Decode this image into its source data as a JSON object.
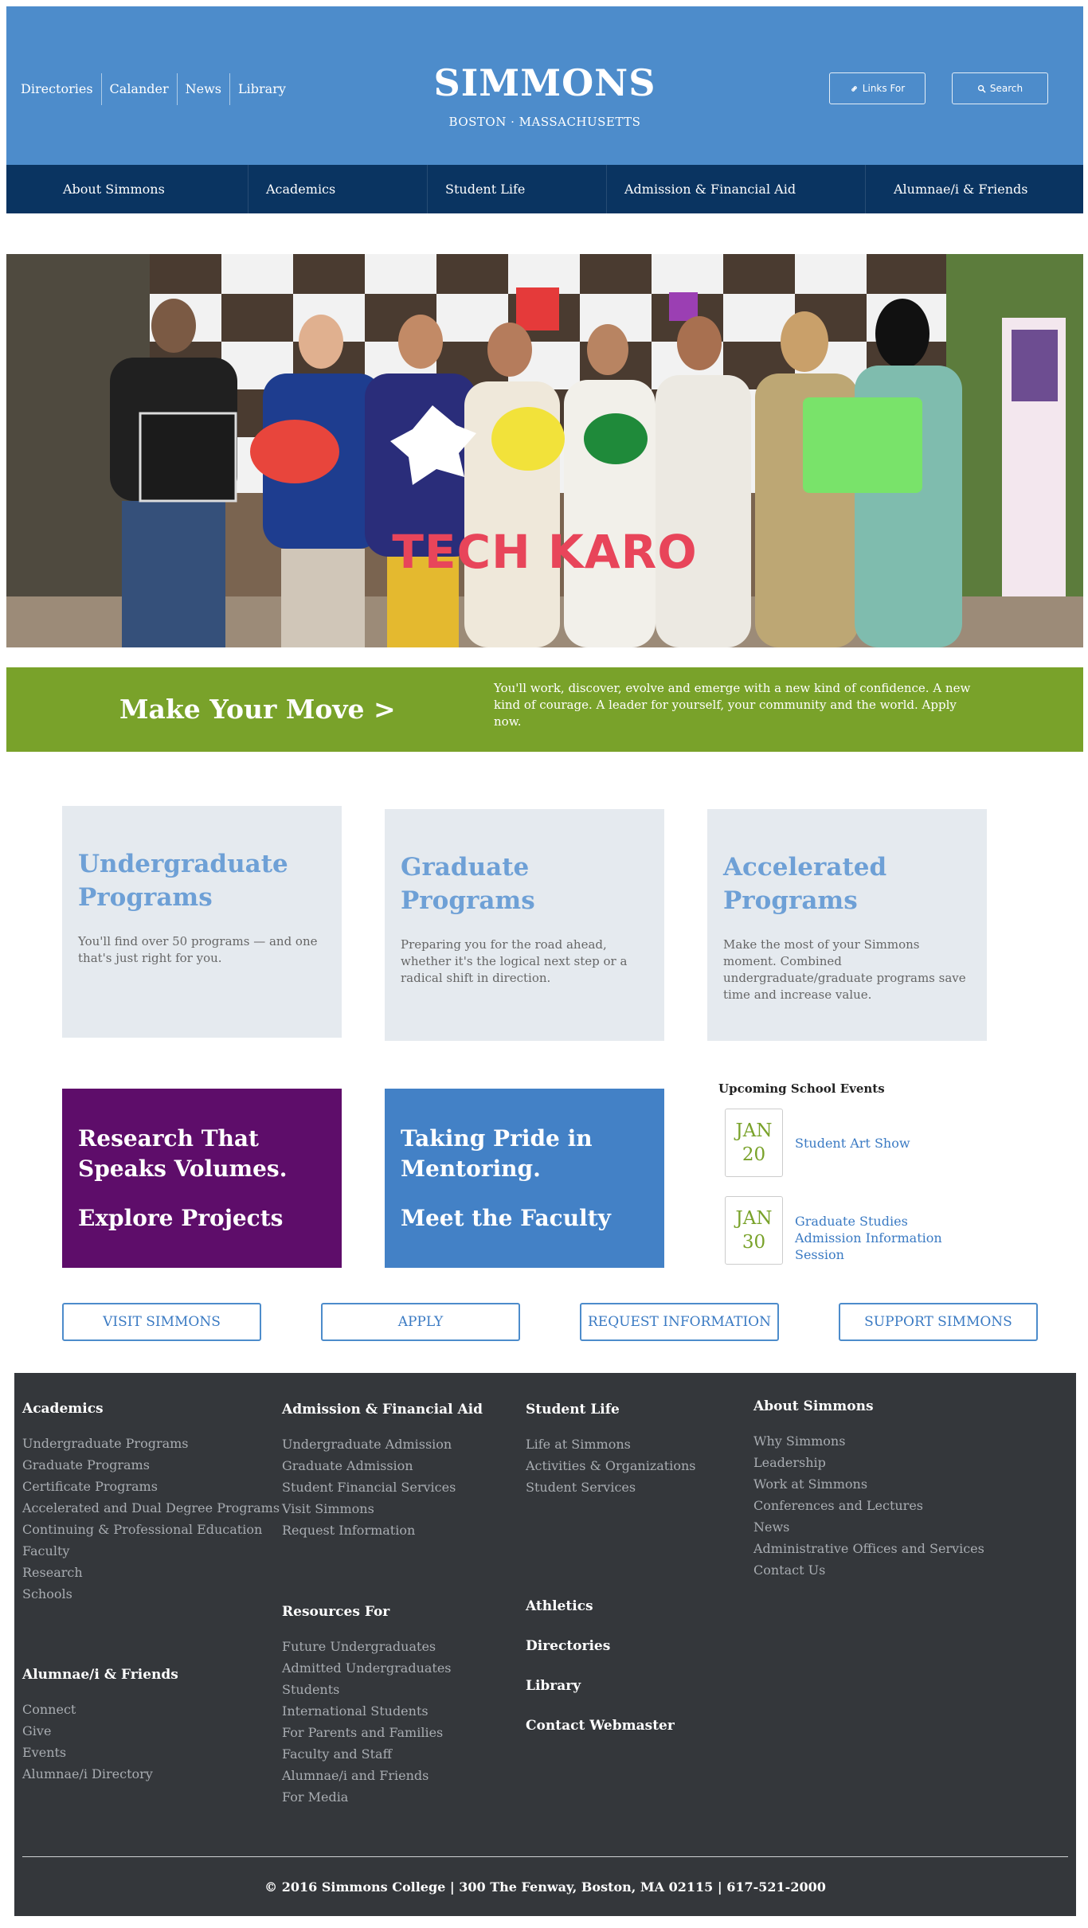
{
  "header": {
    "utility_nav": [
      "Directories",
      "Calander",
      "News",
      "Library"
    ],
    "brand_title": "SIMMONS",
    "brand_subtitle": "BOSTON · MASSACHUSETTS",
    "links_button": "Links For",
    "search_button": "Search"
  },
  "main_nav": [
    "About Simmons",
    "Academics",
    "Student Life",
    "Admission & Financial Aid",
    "Alumnae/i & Friends"
  ],
  "hero": {
    "caption": "TECH KARO"
  },
  "cta": {
    "title": "Make Your Move >",
    "text": "You'll work, discover, evolve and emerge with a new kind of confidence. A new kind of courage. A leader for yourself, your community and the world. Apply now."
  },
  "programs": [
    {
      "title": "Undergraduate Programs",
      "text": "You'll find over 50 programs — and one that's just right for you."
    },
    {
      "title": "Graduate Programs",
      "text": "Preparing you for the road ahead, whether it's the logical next step or a radical shift in direction."
    },
    {
      "title": "Accelerated Programs",
      "text": "Make the most of your Simmons moment. Combined undergraduate/graduate programs save time and increase value."
    }
  ],
  "features": [
    {
      "title": "Research That Speaks Volumes.",
      "link": "Explore Projects"
    },
    {
      "title": "Taking Pride in Mentoring.",
      "link": "Meet the Faculty"
    }
  ],
  "events": {
    "heading": "Upcoming School Events",
    "items": [
      {
        "month": "JAN",
        "day": "20",
        "title": "Student Art Show"
      },
      {
        "month": "JAN",
        "day": "30",
        "title": "Graduate Studies Admission Information Session"
      }
    ]
  },
  "actions": [
    "VISIT SIMMONS",
    "APPLY",
    "REQUEST INFORMATION",
    "SUPPORT SIMMONS"
  ],
  "footer": {
    "academics": {
      "title": "Academics",
      "links": [
        "Undergraduate Programs",
        "Graduate Programs",
        "Certificate Programs",
        "Accelerated and Dual Degree Programs",
        "Continuing & Professional Education",
        "Faculty",
        "Research",
        "Schools"
      ]
    },
    "admission": {
      "title": "Admission & Financial Aid",
      "links": [
        "Undergraduate Admission",
        "Graduate Admission",
        "Student Financial Services",
        "Visit Simmons",
        "Request Information"
      ]
    },
    "student_life": {
      "title": "Student Life",
      "links": [
        "Life at Simmons",
        "Activities & Organizations",
        "Student Services"
      ]
    },
    "about": {
      "title": "About Simmons",
      "links": [
        "Why Simmons",
        "Leadership",
        "Work at Simmons",
        "Conferences and Lectures",
        "News",
        "Administrative Offices and Services",
        "Contact Us"
      ]
    },
    "resources": {
      "title": "Resources For",
      "links": [
        "Future Undergraduates",
        "Admitted Undergraduates",
        "Students",
        "International Students",
        "For Parents and Families",
        "Faculty and Staff",
        "Alumnae/i and Friends",
        "For Media"
      ]
    },
    "alumni": {
      "title": "Alumnae/i & Friends",
      "links": [
        "Connect",
        "Give",
        "Events",
        "Alumnae/i Directory"
      ]
    },
    "solo_links": [
      "Athletics",
      "Directories",
      "Library",
      "Contact Webmaster"
    ],
    "copyright": "© 2016 Simmons College | 300 The Fenway, Boston, MA 02115 | 617-521-2000"
  },
  "colors": {
    "header_blue": "#4d8ccb",
    "nav_navy": "#0a3461",
    "cta_green": "#79a22a",
    "research_purple": "#5e0d6a",
    "mentoring_blue": "#4381c6",
    "footer_dark": "#34373b"
  },
  "icons": {
    "links_button": "link-icon",
    "search_button": "search-icon"
  }
}
